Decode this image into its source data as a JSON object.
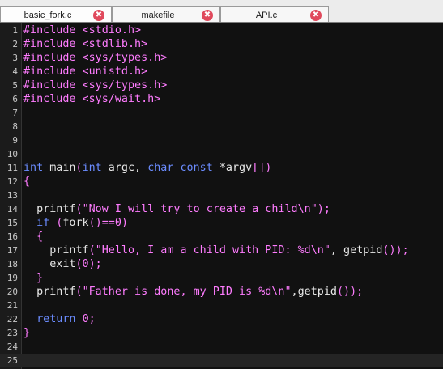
{
  "tabs": [
    {
      "label": "basic_fork.c",
      "active": true
    },
    {
      "label": "makefile",
      "active": false
    },
    {
      "label": "API.c",
      "active": false
    }
  ],
  "close_glyph": "✖",
  "editor": {
    "lines": [
      {
        "n": "1",
        "tokens": [
          {
            "t": "pp",
            "v": "#include <stdio.h>"
          }
        ]
      },
      {
        "n": "2",
        "tokens": [
          {
            "t": "pp",
            "v": "#include <stdlib.h>"
          }
        ]
      },
      {
        "n": "3",
        "tokens": [
          {
            "t": "pp",
            "v": "#include <sys/types.h>"
          }
        ]
      },
      {
        "n": "4",
        "tokens": [
          {
            "t": "pp",
            "v": "#include <unistd.h>"
          }
        ]
      },
      {
        "n": "5",
        "tokens": [
          {
            "t": "pp",
            "v": "#include <sys/types.h>"
          }
        ]
      },
      {
        "n": "6",
        "tokens": [
          {
            "t": "pp",
            "v": "#include <sys/wait.h>"
          }
        ]
      },
      {
        "n": "7",
        "tokens": []
      },
      {
        "n": "8",
        "tokens": []
      },
      {
        "n": "9",
        "tokens": []
      },
      {
        "n": "10",
        "tokens": []
      },
      {
        "n": "11",
        "tokens": [
          {
            "t": "kw",
            "v": "int"
          },
          {
            "t": "def",
            "v": " main"
          },
          {
            "t": "pl",
            "v": "("
          },
          {
            "t": "kw",
            "v": "int"
          },
          {
            "t": "def",
            "v": " argc, "
          },
          {
            "t": "kw",
            "v": "char const"
          },
          {
            "t": "def",
            "v": " *argv"
          },
          {
            "t": "pl",
            "v": "[])"
          }
        ]
      },
      {
        "n": "12",
        "tokens": [
          {
            "t": "pl",
            "v": "{"
          }
        ]
      },
      {
        "n": "13",
        "tokens": []
      },
      {
        "n": "14",
        "tokens": [
          {
            "t": "def",
            "v": "  printf"
          },
          {
            "t": "pl",
            "v": "("
          },
          {
            "t": "str",
            "v": "\"Now I will try to create a child\\n\""
          },
          {
            "t": "pl",
            "v": ");"
          }
        ]
      },
      {
        "n": "15",
        "tokens": [
          {
            "t": "kw",
            "v": "  if"
          },
          {
            "t": "def",
            "v": " "
          },
          {
            "t": "pl",
            "v": "("
          },
          {
            "t": "def",
            "v": "fork"
          },
          {
            "t": "pl",
            "v": "()==0)"
          }
        ]
      },
      {
        "n": "16",
        "tokens": [
          {
            "t": "pl",
            "v": "  {"
          }
        ]
      },
      {
        "n": "17",
        "tokens": [
          {
            "t": "def",
            "v": "    printf"
          },
          {
            "t": "pl",
            "v": "("
          },
          {
            "t": "str",
            "v": "\"Hello, I am a child with PID: %d\\n\""
          },
          {
            "t": "def",
            "v": ", getpid"
          },
          {
            "t": "pl",
            "v": "());"
          }
        ]
      },
      {
        "n": "18",
        "tokens": [
          {
            "t": "def",
            "v": "    exit"
          },
          {
            "t": "pl",
            "v": "(0);"
          }
        ]
      },
      {
        "n": "19",
        "tokens": [
          {
            "t": "pl",
            "v": "  }"
          }
        ]
      },
      {
        "n": "20",
        "tokens": [
          {
            "t": "def",
            "v": "  printf"
          },
          {
            "t": "pl",
            "v": "("
          },
          {
            "t": "str",
            "v": "\"Father is done, my PID is %d\\n\""
          },
          {
            "t": "def",
            "v": ",getpid"
          },
          {
            "t": "pl",
            "v": "());"
          }
        ]
      },
      {
        "n": "21",
        "tokens": []
      },
      {
        "n": "22",
        "tokens": [
          {
            "t": "kw",
            "v": "  return"
          },
          {
            "t": "def",
            "v": " "
          },
          {
            "t": "num",
            "v": "0"
          },
          {
            "t": "pl",
            "v": ";"
          }
        ]
      },
      {
        "n": "23",
        "tokens": [
          {
            "t": "pl",
            "v": "}"
          }
        ]
      },
      {
        "n": "24",
        "tokens": []
      },
      {
        "n": "25",
        "tokens": []
      }
    ],
    "current_line": "25"
  },
  "colors": {
    "preprocessor": "#ff7cff",
    "keyword": "#6b8cff",
    "string": "#ff7cff",
    "default": "#e8e8e8",
    "close_button": "#e0495c"
  }
}
